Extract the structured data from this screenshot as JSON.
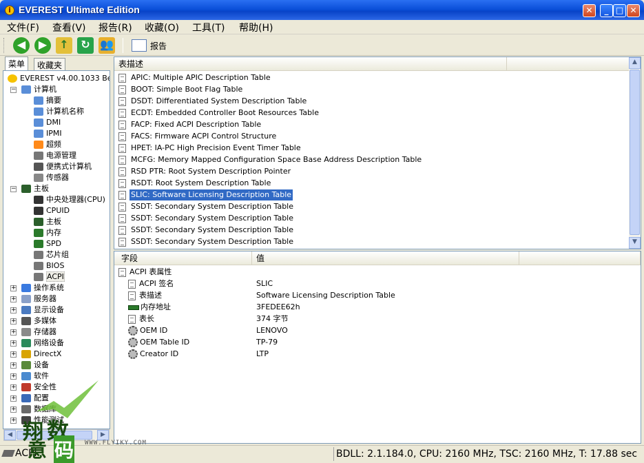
{
  "window": {
    "title": "EVEREST Ultimate Edition",
    "controls": [
      "minimize",
      "maximize",
      "close"
    ]
  },
  "menu": [
    "文件(F)",
    "查看(V)",
    "报告(R)",
    "收藏(O)",
    "工具(T)",
    "帮助(H)"
  ],
  "toolbar": {
    "buttons": [
      "back",
      "forward",
      "up",
      "refresh",
      "users"
    ],
    "report_label": "报告"
  },
  "left_tabs": [
    "菜单",
    "收藏夹"
  ],
  "tree": [
    {
      "label": "EVEREST v4.00.1033 Beta",
      "icon": "info-icon",
      "level": 0
    },
    {
      "label": "计算机",
      "icon": "computer-icon",
      "level": 1,
      "expander": "−"
    },
    {
      "label": "摘要",
      "icon": "computer-icon",
      "level": 2
    },
    {
      "label": "计算机名称",
      "icon": "computer-icon",
      "level": 2
    },
    {
      "label": "DMI",
      "icon": "computer-icon",
      "level": 2
    },
    {
      "label": "IPMI",
      "icon": "computer-icon",
      "level": 2
    },
    {
      "label": "超频",
      "icon": "flame-icon",
      "level": 2
    },
    {
      "label": "电源管理",
      "icon": "power-icon",
      "level": 2
    },
    {
      "label": "便携式计算机",
      "icon": "laptop-icon",
      "level": 2
    },
    {
      "label": "传感器",
      "icon": "sensor-icon",
      "level": 2
    },
    {
      "label": "主板",
      "icon": "motherboard-icon",
      "level": 1,
      "expander": "−"
    },
    {
      "label": "中央处理器(CPU)",
      "icon": "cpu-icon",
      "level": 2
    },
    {
      "label": "CPUID",
      "icon": "cpu-icon",
      "level": 2
    },
    {
      "label": "主板",
      "icon": "motherboard-icon",
      "level": 2
    },
    {
      "label": "内存",
      "icon": "memory-icon",
      "level": 2
    },
    {
      "label": "SPD",
      "icon": "memory-icon",
      "level": 2
    },
    {
      "label": "芯片组",
      "icon": "chip-icon",
      "level": 2
    },
    {
      "label": "BIOS",
      "icon": "chip-icon",
      "level": 2
    },
    {
      "label": "ACPI",
      "icon": "chip-icon",
      "level": 2,
      "selected": true
    },
    {
      "label": "操作系统",
      "icon": "windows-icon",
      "level": 1,
      "expander": "+"
    },
    {
      "label": "服务器",
      "icon": "server-icon",
      "level": 1,
      "expander": "+"
    },
    {
      "label": "显示设备",
      "icon": "display-icon",
      "level": 1,
      "expander": "+"
    },
    {
      "label": "多媒体",
      "icon": "multimedia-icon",
      "level": 1,
      "expander": "+"
    },
    {
      "label": "存储器",
      "icon": "storage-icon",
      "level": 1,
      "expander": "+"
    },
    {
      "label": "网络设备",
      "icon": "network-icon",
      "level": 1,
      "expander": "+"
    },
    {
      "label": "DirectX",
      "icon": "directx-icon",
      "level": 1,
      "expander": "+"
    },
    {
      "label": "设备",
      "icon": "devices-icon",
      "level": 1,
      "expander": "+"
    },
    {
      "label": "软件",
      "icon": "software-icon",
      "level": 1,
      "expander": "+"
    },
    {
      "label": "安全性",
      "icon": "security-icon",
      "level": 1,
      "expander": "+"
    },
    {
      "label": "配置",
      "icon": "config-icon",
      "level": 1,
      "expander": "+"
    },
    {
      "label": "数据库",
      "icon": "database-icon",
      "level": 1,
      "expander": "+"
    },
    {
      "label": "性能测试",
      "icon": "benchmark-icon",
      "level": 1,
      "expander": "+"
    }
  ],
  "table_list": {
    "header": "表描述",
    "rows": [
      "APIC: Multiple APIC Description Table",
      "BOOT: Simple Boot Flag Table",
      "DSDT: Differentiated System Description Table",
      "ECDT: Embedded Controller Boot Resources Table",
      "FACP: Fixed ACPI Description Table",
      "FACS: Firmware ACPI Control Structure",
      "HPET: IA-PC High Precision Event Timer Table",
      "MCFG: Memory Mapped Configuration Space Base Address Description Table",
      "RSD PTR: Root System Description Pointer",
      "RSDT: Root System Description Table",
      "SLIC: Software Licensing Description Table",
      "SSDT: Secondary System Description Table",
      "SSDT: Secondary System Description Table",
      "SSDT: Secondary System Description Table",
      "SSDT: Secondary System Description Table"
    ],
    "selected_index": 10
  },
  "details": {
    "col_field": "字段",
    "col_value": "值",
    "group": "ACPI 表属性",
    "rows": [
      {
        "field": "ACPI 签名",
        "value": "SLIC",
        "icon": "document-icon"
      },
      {
        "field": "表描述",
        "value": "Software Licensing Description Table",
        "icon": "document-icon"
      },
      {
        "field": "内存地址",
        "value": "3FEDEE62h",
        "icon": "memory-icon"
      },
      {
        "field": "表长",
        "value": "374 字节",
        "icon": "document-icon"
      },
      {
        "field": "OEM ID",
        "value": "LENOVO",
        "icon": "gear-icon"
      },
      {
        "field": "OEM Table ID",
        "value": "TP-79",
        "icon": "gear-icon"
      },
      {
        "field": "Creator ID",
        "value": "LTP",
        "icon": "gear-icon"
      }
    ]
  },
  "status": {
    "left": "ACPI",
    "right": "BDLL: 2.1.184.0, CPU: 2160 MHz, TSC: 2160 MHz, T: 17.88 sec"
  },
  "watermark": {
    "chars": [
      "翔",
      "数",
      "意",
      "码"
    ],
    "url": "WWW.FLYIKY.COM"
  },
  "colors": {
    "selection": "#316ac5",
    "titlebar": "#0a4fd8"
  }
}
